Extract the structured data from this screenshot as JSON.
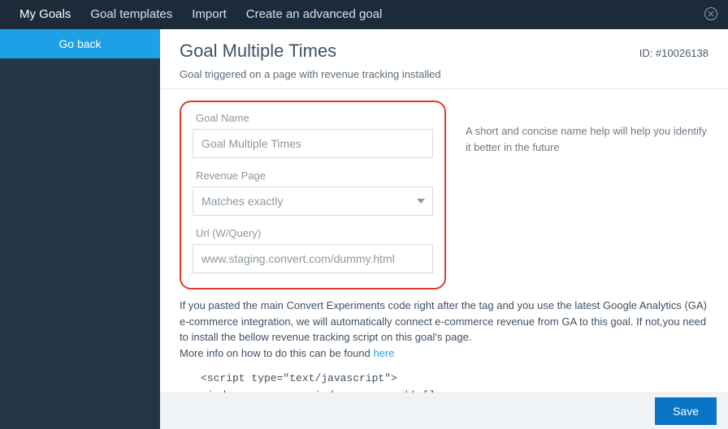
{
  "topnav": {
    "my_goals": "My Goals",
    "goal_templates": "Goal templates",
    "import": "Import",
    "create_advanced": "Create an advanced goal"
  },
  "sidebar": {
    "go_back": "Go back"
  },
  "header": {
    "title": "Goal Multiple Times",
    "id_label": "ID: #10026138",
    "subtitle": "Goal triggered on a page with revenue tracking installed"
  },
  "form": {
    "goal_name_label": "Goal Name",
    "goal_name_value": "Goal Multiple Times",
    "revenue_page_label": "Revenue Page",
    "revenue_page_value": "Matches exactly",
    "url_label": "Url (W/Query)",
    "url_value": "www.staging.convert.com/dummy.html"
  },
  "help": {
    "name_help": "A short and concise name help will help you identify it better in the future"
  },
  "paragraph": {
    "text_before": "If you pasted the main Convert Experiments code right after the tag and you use the latest Google Analytics (GA) e-commerce integration, we will automatically connect e-commerce revenue from GA to this goal. If not,you need to install the bellow revenue tracking script on this goal's page.\nMore info on how to do this can be found ",
    "link": "here"
  },
  "code_block": "<script type=\"text/javascript\">\nwindow._conv_q = window._conv_q || [];\n_conv_q.push([\"pushRevenue\",\"revenue\",\"products_cnt\",\"10026138\"]);",
  "footer": {
    "save": "Save"
  }
}
